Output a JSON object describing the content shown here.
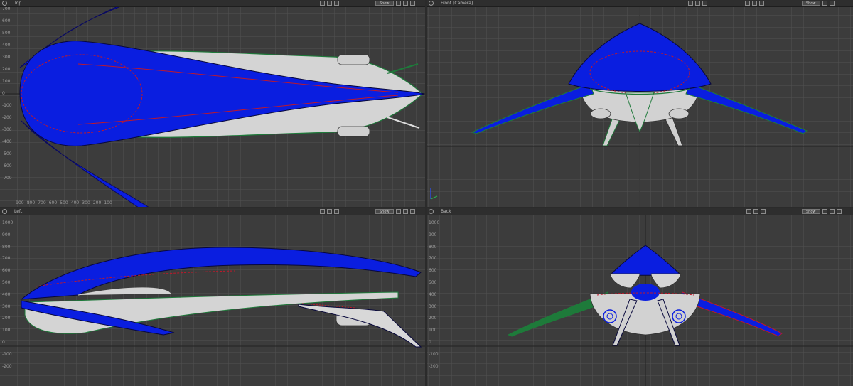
{
  "viewports": [
    {
      "id": "top",
      "title": "Top",
      "show_label": "Show"
    },
    {
      "id": "front",
      "title": "Front [Camera]",
      "show_label": "Show"
    },
    {
      "id": "left",
      "title": "Left",
      "show_label": "Show"
    },
    {
      "id": "back",
      "title": "Back",
      "show_label": "Show"
    }
  ],
  "rulers": {
    "top_view": [
      "700",
      "600",
      "500",
      "400",
      "300",
      "200",
      "100",
      "0",
      "-100",
      "-200",
      "-300",
      "-400",
      "-500",
      "-600",
      "-700"
    ],
    "top_view_h": "-900 -800 -700 -600 -500 -400 -300 -200 -100",
    "left_view": [
      "1000",
      "900",
      "800",
      "700",
      "600",
      "500",
      "400",
      "300",
      "200",
      "100",
      "0",
      "-100",
      "-200"
    ],
    "back_view": [
      "1000",
      "900",
      "800",
      "700",
      "600",
      "500",
      "400",
      "300",
      "200",
      "100",
      "0",
      "-100",
      "-200"
    ]
  },
  "colors": {
    "viewport_bg": "#3c3c3c",
    "grid": "#525252",
    "hull_blue": "#0a1ee0",
    "hull_white": "#d8d8d8",
    "edge_green": "#1e7a3a",
    "edge_red": "#c0182a"
  }
}
